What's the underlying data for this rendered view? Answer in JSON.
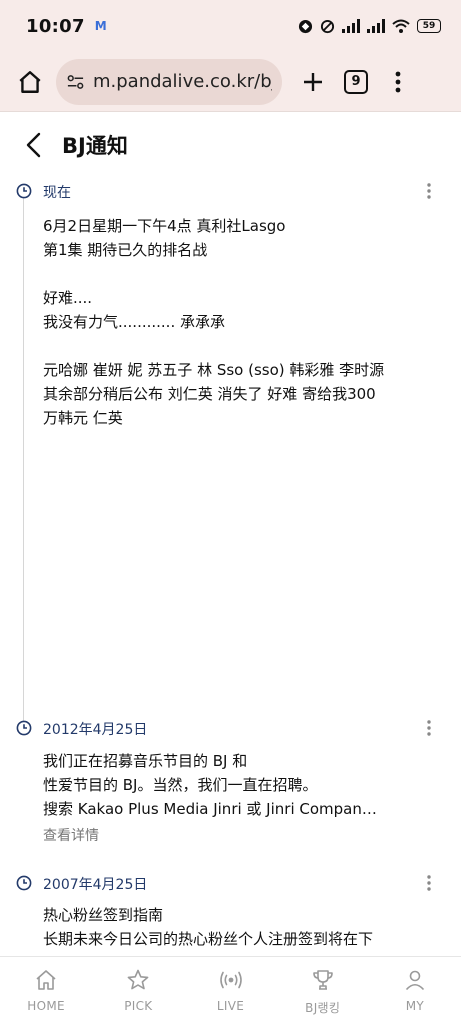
{
  "status_bar": {
    "time": "10:07",
    "notification_letter": "M",
    "battery": "59"
  },
  "browser": {
    "url": "m.pandalive.co.kr/bjl",
    "tab_count": "9"
  },
  "header": {
    "title": "BJ通知"
  },
  "entries": [
    {
      "date": "现在",
      "lines": [
        "6月2日星期一下午4点 真利社Lasgo",
        "第1集 期待已久的排名战",
        "",
        "好难....",
        "我没有力气............ 承承承",
        "",
        "元哈娜 崔妍 妮 苏五子 林 Sso (sso) 韩彩雅 李时源",
        "其余部分稍后公布 刘仁英 消失了 好难 寄给我300",
        "万韩元 仁英"
      ]
    },
    {
      "date": "2012年4月25日",
      "lines": [
        "我们正在招募音乐节目的 BJ 和",
        "性爱节目的 BJ。当然，我们一直在招聘。",
        "搜索 Kakao Plus Media Jinri 或 Jinri Compan…"
      ],
      "more": "查看详情"
    },
    {
      "date": "2007年4月25日",
      "lines": [
        "热心粉丝签到指南",
        "长期未来今日公司的热心粉丝个人注册签到将在下"
      ]
    }
  ],
  "bottom_nav": [
    {
      "label": "HOME",
      "icon": "home-icon"
    },
    {
      "label": "PICK",
      "icon": "star-icon"
    },
    {
      "label": "LIVE",
      "icon": "live-icon"
    },
    {
      "label": "BJ랭킹",
      "icon": "trophy-icon"
    },
    {
      "label": "MY",
      "icon": "person-icon"
    }
  ]
}
